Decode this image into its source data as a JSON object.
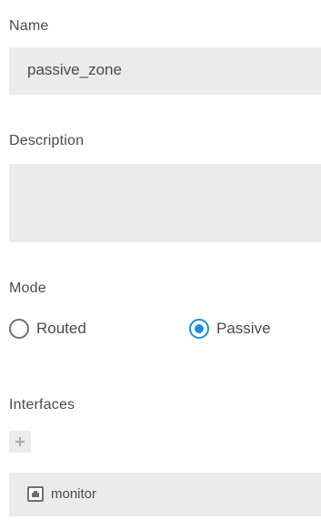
{
  "form": {
    "name": {
      "label": "Name",
      "value": "passive_zone"
    },
    "description": {
      "label": "Description",
      "value": ""
    },
    "mode": {
      "label": "Mode",
      "options": [
        {
          "label": "Routed",
          "selected": false
        },
        {
          "label": "Passive",
          "selected": true
        }
      ]
    },
    "interfaces": {
      "label": "Interfaces",
      "add_icon": "plus-icon",
      "items": [
        {
          "icon": "interface-icon",
          "label": "monitor"
        }
      ]
    }
  },
  "colors": {
    "field_bg": "#ebebeb",
    "accent": "#1e8fd6",
    "text": "#4a4a4a"
  }
}
